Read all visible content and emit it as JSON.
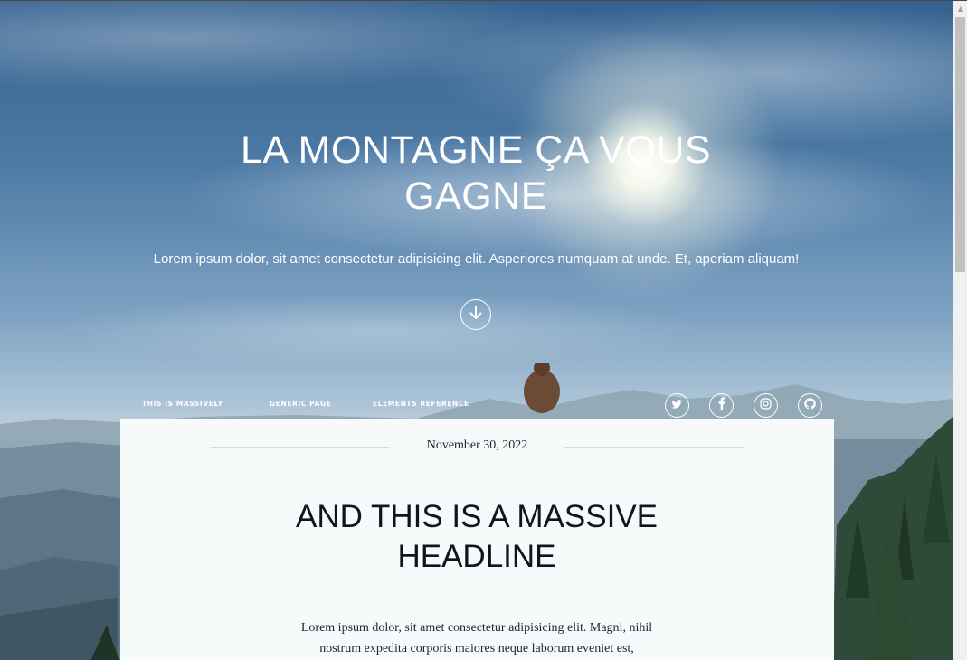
{
  "intro": {
    "title": "LA MONTAGNE ÇA VOUS GAGNE",
    "text": "Lorem ipsum dolor, sit amet consectetur adipisicing elit. Asperiores numquam at unde. Et, aperiam aliquam!",
    "scroll_icon": "arrow-down-icon"
  },
  "nav": {
    "links": [
      {
        "label": "This is Massively"
      },
      {
        "label": "Generic Page"
      },
      {
        "label": "Elements Reference"
      }
    ],
    "social": [
      {
        "icon": "twitter-icon"
      },
      {
        "icon": "facebook-icon"
      },
      {
        "icon": "instagram-icon"
      },
      {
        "icon": "github-icon"
      }
    ]
  },
  "post": {
    "date": "November 30, 2022",
    "headline": "AND THIS IS A MASSIVE HEADLINE",
    "body": "Lorem ipsum dolor, sit amet consectetur adipisicing elit. Magni, nihil nostrum expedita corporis maiores neque laborum eveniet est,"
  },
  "colors": {
    "panel": "#f6fafb",
    "text_dark": "#0f151b",
    "white": "#ffffff"
  }
}
